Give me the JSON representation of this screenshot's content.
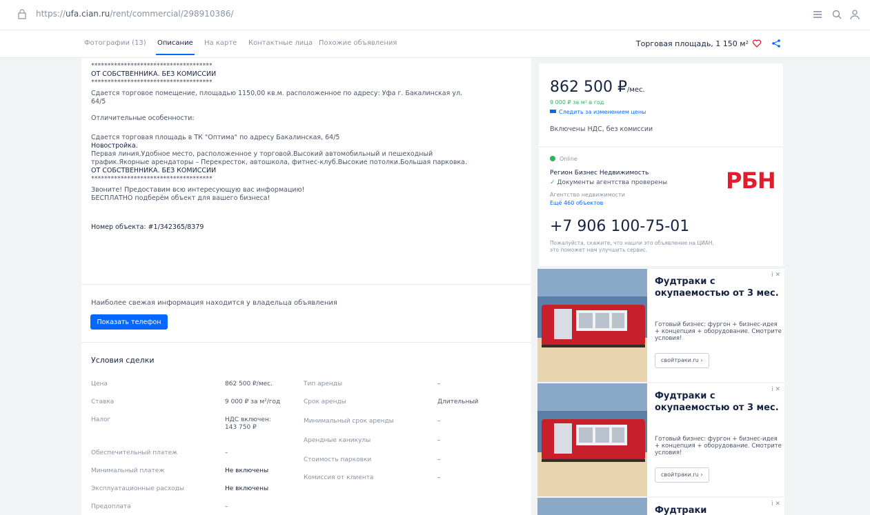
{
  "address_bar": {
    "url_prefix": "https://",
    "url_host": "ufa.cian.ru",
    "url_path": "/rent/commercial/298910386/"
  },
  "tabs": [
    {
      "label": "Фотографии (13)",
      "active": false
    },
    {
      "label": "Описание",
      "active": true
    },
    {
      "label": "На карте",
      "active": false
    },
    {
      "label": "Контактные лица",
      "active": false
    },
    {
      "label": "Похожие объявления",
      "active": false
    }
  ],
  "tab_area_label": "Торговая площадь, 1 150 м²",
  "description": {
    "lines": [
      "*************************************",
      "ОТ СОБСТВЕННИКА. БЕЗ КОМИССИИ",
      "*************************************",
      "Сдается  торговое помещение, площадью  1150,00 кв.м. расположенное по адресу: Уфа г. Бакалинская ул.",
      "64/5",
      "",
      "Отличительные особенности:",
      "",
      "Сдается торговая площадь в ТК \"Оптима\" по адресу Бакалинская, 64/5",
      "Новостройка.",
      "Первая линия,Удобное место, расположенное у торговой.Высокий автомобильный и пешеходный",
      "трафик.Якорные арендаторы – Перекресток, автошкола, фитнес-клуб.Высокие потолки.Большая парковка.",
      "ОТ СОБСТВЕННИКА. БЕЗ КОМИССИИ",
      "*************************************",
      "Звоните! Предоставим всю интересующую вас информацию!",
      "БЕСПЛАТНО подберём объект для вашего бизнеса!",
      "",
      "",
      "Номер объекта: #1/342365/8379"
    ]
  },
  "owner_note": "Наиболее свежая информация находится у владельца объявления",
  "show_phone_label": "Показать телефон",
  "deal": {
    "title": "Условия сделки",
    "left_labels": [
      "Цена",
      "Ставка",
      "Налог",
      "Обеспечительный платеж",
      "Минимальный платеж",
      "Эксплуатационные расходы",
      "Предоплата"
    ],
    "left_values": [
      "862 500 ₽/мес.",
      "9 000 ₽ за м²/год",
      "НДС включен: 143 750 ₽",
      "–",
      "Не включены",
      "Не включены",
      "–"
    ],
    "right_labels": [
      "Тип аренды",
      "Срок аренды",
      "Минимальный срок аренды",
      "Арендные каникулы",
      "Стоимость парковки",
      "Комиссия от клиента"
    ],
    "right_values": [
      "–",
      "Длительный",
      "–",
      "–",
      "–",
      "–"
    ]
  },
  "price_card": {
    "price": "862 500 ₽",
    "per": "/мес.",
    "per_m2": "9 000 ₽ за м² в год",
    "follow": "Следить за изменением цены",
    "tax": "Включены НДС, без комиссии"
  },
  "agent_card": {
    "status": "Online",
    "name": "Регион Бизнес Недвижимость",
    "verified": "Документы агентства проверены",
    "type": "Агентство недвижимости",
    "more": "Ещё 460 объектов",
    "logo_text": "РБН",
    "phone": "+7 906 100-75-01",
    "note": "Пожалуйста, скажите, что нашли это объявление на ЦИАН, это поможет нам улучшить сервис."
  },
  "ads": [
    {
      "title": "Фудтраки с окупаемостью от 3 мес.",
      "text": "Готовый бизнес: фургон + бизнес-идея + концепция + оборудование. Смотрите условия!",
      "link": "свойтраки.ru ›"
    },
    {
      "title": "Фудтраки с окупаемостью от 3 мес.",
      "text": "Готовый бизнес: фургон + бизнес-идея + концепция + оборудование. Смотрите условия!",
      "link": "свойтраки.ru ›"
    },
    {
      "title": "Фудтраки",
      "text": "",
      "link": ""
    }
  ],
  "colors": {
    "accent_blue": "#0468ff",
    "brand_red": "#e11d2c",
    "online_green": "#2bb55a",
    "text_dark": "#152242"
  },
  "icons": [
    "lock-icon",
    "menu-icon",
    "search-icon",
    "profile-icon",
    "heart-icon",
    "share-icon",
    "close-icon"
  ]
}
